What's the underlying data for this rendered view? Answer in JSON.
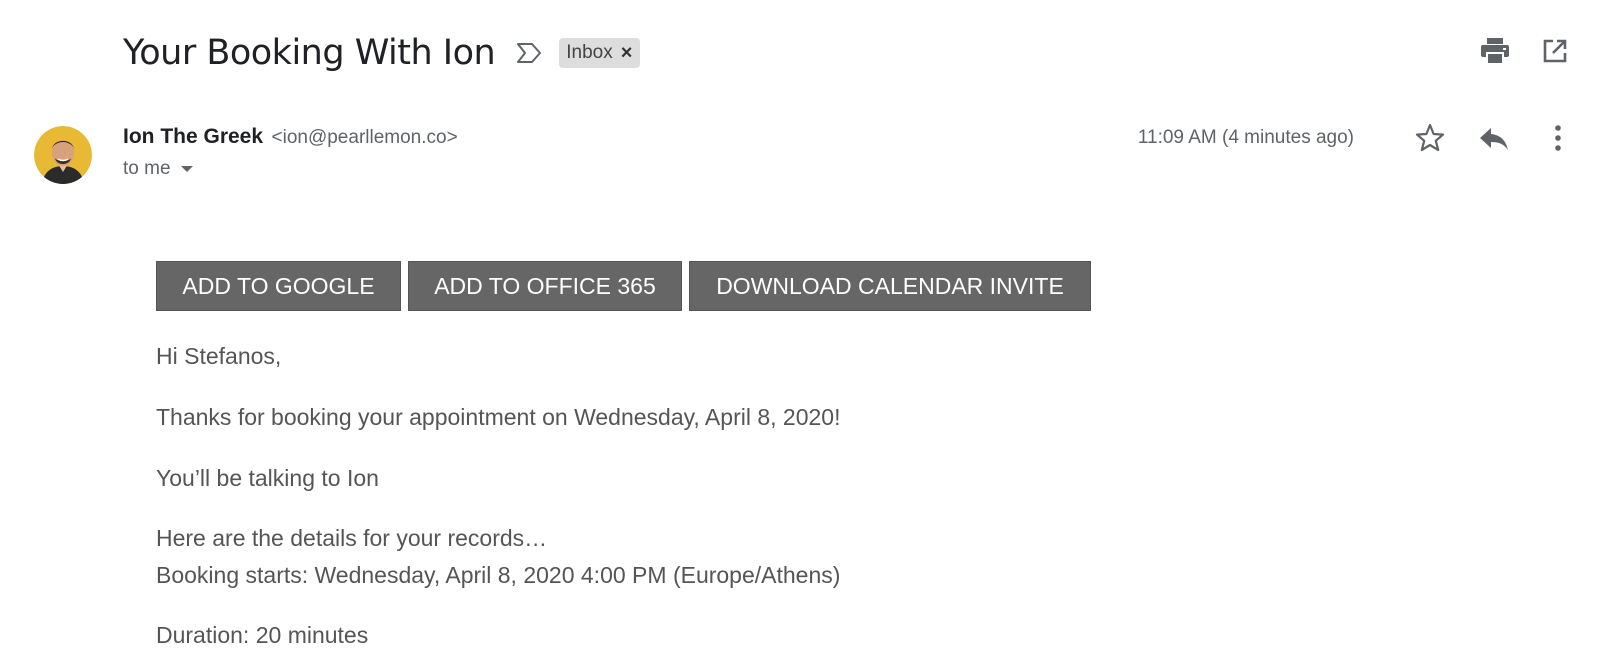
{
  "header": {
    "subject": "Your Booking With Ion",
    "label_chip": "Inbox",
    "label_remove": "×"
  },
  "sender": {
    "name": "Ion The Greek",
    "email": "<ion@pearllemon.co>",
    "recipient": "to me",
    "timestamp": "11:09 AM (4 minutes ago)"
  },
  "actions": {
    "add_google": "ADD TO GOOGLE",
    "add_office": "ADD TO OFFICE 365",
    "download_invite": "DOWNLOAD CALENDAR INVITE"
  },
  "body": {
    "greeting": "Hi Stefanos,",
    "thanks": "Thanks for booking your appointment on Wednesday, April 8, 2020!",
    "talking_to": "You’ll be talking to Ion",
    "details_intro": "Here are the details for your records…",
    "booking_starts": "Booking starts: Wednesday, April 8, 2020 4:00 PM (Europe/Athens)",
    "duration": "Duration: 20 minutes"
  },
  "icons": {
    "importance": "label-importance-icon",
    "print": "print-icon",
    "open_new_window": "open-in-new-window-icon",
    "star": "star-icon",
    "reply": "reply-icon",
    "more": "more-vertical-icon"
  },
  "colors": {
    "button_bg": "#666666",
    "text_primary": "#202124",
    "text_secondary": "#5f6368",
    "body_text": "#555555",
    "chip_bg": "#dddddd"
  }
}
